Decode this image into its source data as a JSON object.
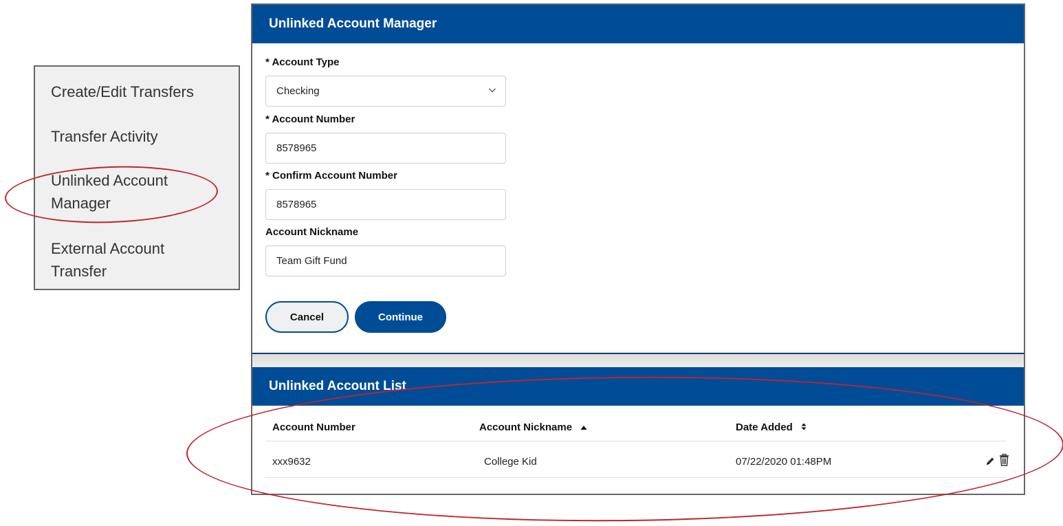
{
  "side_menu": {
    "items": [
      {
        "label": "Create/Edit Transfers"
      },
      {
        "label": "Transfer Activity"
      },
      {
        "label": "Unlinked Account Manager"
      },
      {
        "label": "External Account Transfer"
      }
    ]
  },
  "manager": {
    "title": "Unlinked Account Manager",
    "account_type": {
      "label": "* Account Type",
      "value": "Checking"
    },
    "account_number": {
      "label": "* Account Number",
      "value": "8578965"
    },
    "confirm_account_number": {
      "label": "* Confirm Account Number",
      "value": "8578965"
    },
    "account_nickname": {
      "label": "Account Nickname",
      "value": "Team Gift Fund"
    },
    "cancel_label": "Cancel",
    "continue_label": "Continue"
  },
  "list": {
    "title": "Unlinked Account List",
    "columns": {
      "account_number": "Account Number",
      "account_nickname": "Account Nickname",
      "date_added": "Date Added"
    },
    "rows": [
      {
        "account_number": "xxx9632",
        "account_nickname": "College Kid",
        "date_added": "07/22/2020 01:48PM"
      }
    ]
  },
  "colors": {
    "brand_blue": "#004c97",
    "highlight_red": "#c0242d"
  },
  "icons": [
    "chevron-down-icon",
    "sort-asc-icon",
    "sort-both-icon",
    "pencil-icon",
    "trash-icon"
  ]
}
